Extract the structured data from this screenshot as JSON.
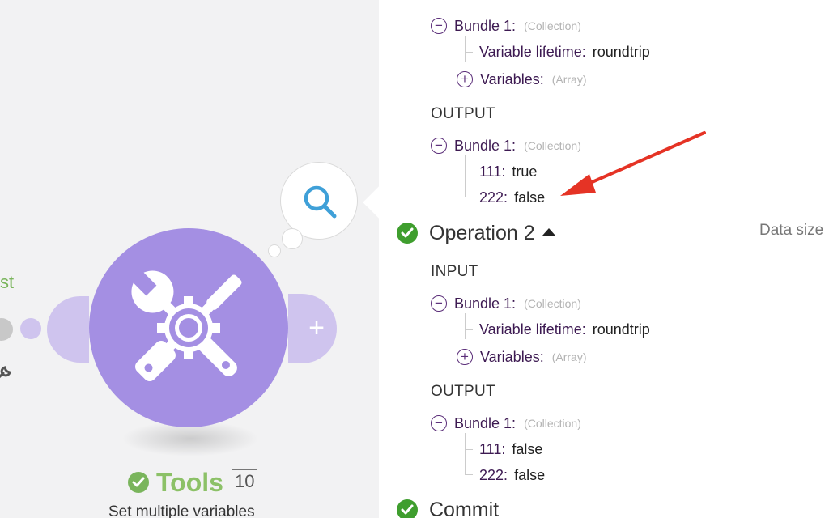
{
  "canvas": {
    "partial_label": "st",
    "module": {
      "name": "Tools",
      "count": "10",
      "subtitle": "Set multiple variables",
      "color": "#a48fe3"
    },
    "add_button_label": "+"
  },
  "panel": {
    "operation1": {
      "input_bundle": {
        "label": "Bundle 1:",
        "type": "(Collection)",
        "items": [
          {
            "key": "Variable lifetime",
            "value": "roundtrip"
          }
        ],
        "variables": {
          "key": "Variables",
          "type": "(Array)"
        }
      },
      "output_label": "OUTPUT",
      "output_bundle": {
        "label": "Bundle 1:",
        "type": "(Collection)",
        "items": [
          {
            "key": "111",
            "value": "true"
          },
          {
            "key": "222",
            "value": "false"
          }
        ]
      }
    },
    "operation2": {
      "title": "Operation 2",
      "data_size_label": "Data size",
      "input_label": "INPUT",
      "input_bundle": {
        "label": "Bundle 1:",
        "type": "(Collection)",
        "items": [
          {
            "key": "Variable lifetime",
            "value": "roundtrip"
          }
        ],
        "variables": {
          "key": "Variables",
          "type": "(Array)"
        }
      },
      "output_label": "OUTPUT",
      "output_bundle": {
        "label": "Bundle 1:",
        "type": "(Collection)",
        "items": [
          {
            "key": "111",
            "value": "false"
          },
          {
            "key": "222",
            "value": "false"
          }
        ]
      }
    },
    "commit": {
      "title": "Commit"
    }
  },
  "icons": {
    "collapse": "minus-circle-icon",
    "expand": "plus-circle-icon",
    "success": "check-circle-icon",
    "search": "magnifier-icon",
    "module": "tools-icon"
  },
  "colors": {
    "accent_purple": "#5b2e79",
    "success_green": "#3f9e2e",
    "module_green": "#8cc167",
    "annotation_red": "#e53325",
    "search_blue": "#3fa0d8"
  }
}
